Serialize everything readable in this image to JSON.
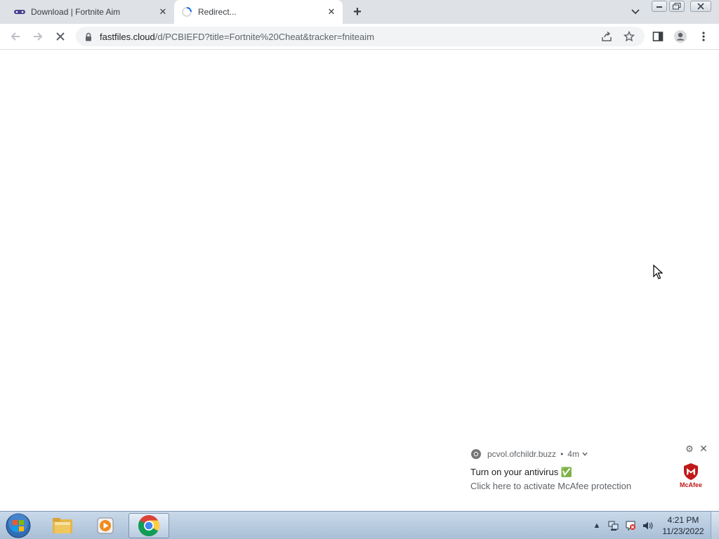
{
  "browser": {
    "tabs": [
      {
        "title": "Download | Fortnite Aim",
        "favicon": "game-controller-icon",
        "active": false
      },
      {
        "title": "Redirect...",
        "favicon": "loading-spinner-icon",
        "active": true
      }
    ],
    "address_bar": {
      "host": "fastfiles.cloud",
      "path": "/d/PCBIEFD?title=Fortnite%20Cheat&tracker=fniteaim"
    }
  },
  "notification": {
    "source": "pcvol.ofchildr.buzz",
    "age": "4m",
    "bullet": "•",
    "title": "Turn on your antivirus ✅",
    "body": "Click here to activate McAfee protection",
    "brand": "McAfee",
    "brand_color": "#c01818"
  },
  "taskbar": {
    "clock_time": "4:21 PM",
    "clock_date": "11/23/2022"
  }
}
